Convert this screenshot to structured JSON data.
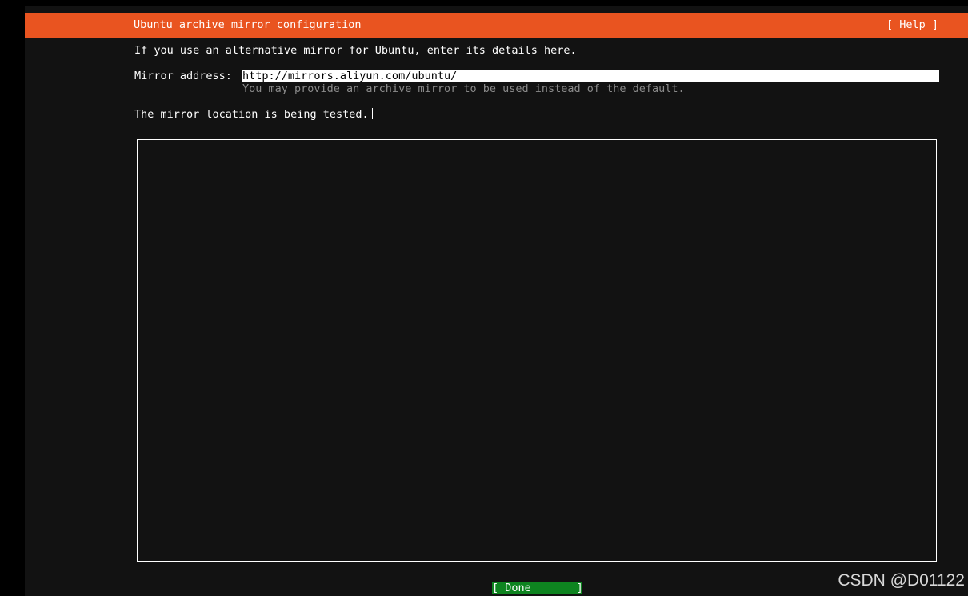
{
  "header": {
    "title": "Ubuntu archive mirror configuration",
    "help_label": "[ Help ]"
  },
  "form": {
    "intro_text": "If you use an alternative mirror for Ubuntu, enter its details here.",
    "mirror_label": "Mirror address:",
    "mirror_value": "http://mirrors.aliyun.com/ubuntu/",
    "mirror_hint": "You may provide an archive mirror to be used instead of the default.",
    "status_text": "The mirror location is being tested."
  },
  "footer": {
    "done_label": "[ Done       ]"
  },
  "watermark": "CSDN @D01122",
  "colors": {
    "header_bg": "#e95420",
    "background": "#121212",
    "done_bg": "#0e8420",
    "hint_text": "#8a8a8a"
  }
}
